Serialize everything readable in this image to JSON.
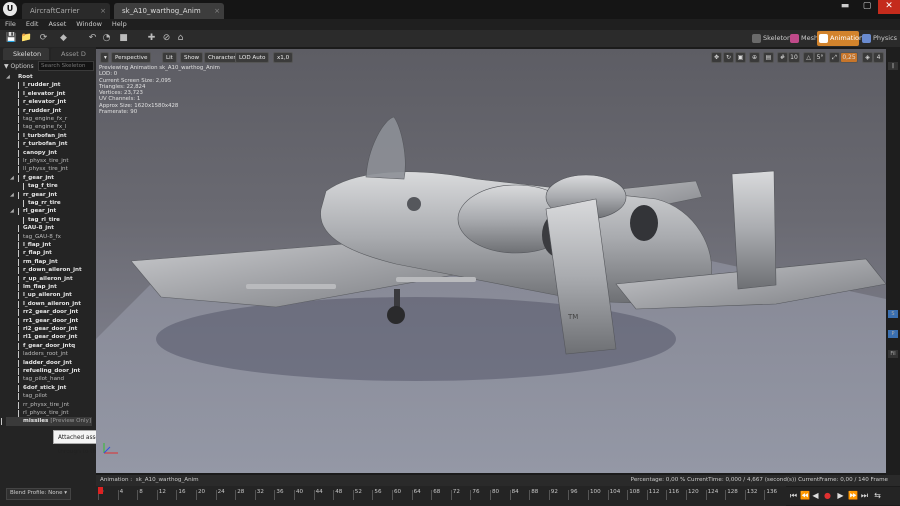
{
  "title_bar": {
    "tabs": [
      {
        "label": "AircraftCarrier",
        "close": "×"
      },
      {
        "label": "sk_A10_warthog_Anim",
        "close": "×"
      }
    ],
    "logo_letter": "U",
    "window_controls": [
      "▬",
      "▢",
      "✕"
    ]
  },
  "menu": [
    "File",
    "Edit",
    "Asset",
    "Window",
    "Help"
  ],
  "modes": [
    {
      "label": "Skeleton",
      "color": "#6a6a6a"
    },
    {
      "label": "Mesh",
      "color": "#c04a8a"
    },
    {
      "label": "Animation",
      "color": "#ffffff"
    },
    {
      "label": "Physics",
      "color": "#6a8bd0"
    }
  ],
  "left_panel": {
    "tabs": [
      "Skeleton",
      "Asset D"
    ],
    "options_label": "Options",
    "search_placeholder": "Search Skeleton",
    "tree": [
      {
        "label": "Root",
        "bold": true,
        "indent": 0
      },
      {
        "label": "l_rudder_jnt",
        "bold": true,
        "indent": 1
      },
      {
        "label": "l_elevator_jnt",
        "bold": true,
        "indent": 1
      },
      {
        "label": "r_elevator_jnt",
        "bold": true,
        "indent": 1
      },
      {
        "label": "r_rudder_jnt",
        "bold": true,
        "indent": 1
      },
      {
        "label": "tag_engine_fx_r",
        "bold": false,
        "indent": 1
      },
      {
        "label": "tag_engine_fx_l",
        "bold": false,
        "indent": 1
      },
      {
        "label": "l_turbofan_jnt",
        "bold": true,
        "indent": 1
      },
      {
        "label": "r_turbofan_jnt",
        "bold": true,
        "indent": 1
      },
      {
        "label": "canopy_jnt",
        "bold": true,
        "indent": 1
      },
      {
        "label": "lr_physx_tire_jnt",
        "bold": false,
        "indent": 1
      },
      {
        "label": "ll_physx_tire_jnt",
        "bold": false,
        "indent": 1
      },
      {
        "label": "f_gear_jnt",
        "bold": true,
        "indent": 1,
        "expand": true
      },
      {
        "label": "tag_f_tire",
        "bold": true,
        "indent": 2
      },
      {
        "label": "rr_gear_jnt",
        "bold": true,
        "indent": 1,
        "expand": true
      },
      {
        "label": "tag_rr_tire",
        "bold": true,
        "indent": 2
      },
      {
        "label": "rl_gear_jnt",
        "bold": true,
        "indent": 1,
        "expand": true
      },
      {
        "label": "tag_rl_tire",
        "bold": true,
        "indent": 2
      },
      {
        "label": "GAU-8_jnt",
        "bold": true,
        "indent": 1
      },
      {
        "label": "tag_GAU-8_fx",
        "bold": false,
        "indent": 1
      },
      {
        "label": "l_flap_jnt",
        "bold": true,
        "indent": 1
      },
      {
        "label": "r_flap_jnt",
        "bold": true,
        "indent": 1
      },
      {
        "label": "rm_flap_jnt",
        "bold": true,
        "indent": 1
      },
      {
        "label": "r_down_aileron_jnt",
        "bold": true,
        "indent": 1
      },
      {
        "label": "r_up_aileron_jnt",
        "bold": true,
        "indent": 1
      },
      {
        "label": "lm_flap_jnt",
        "bold": true,
        "indent": 1
      },
      {
        "label": "l_up_aileron_jnt",
        "bold": true,
        "indent": 1
      },
      {
        "label": "l_down_aileron_jnt",
        "bold": true,
        "indent": 1
      },
      {
        "label": "rr2_gear_door_jnt",
        "bold": true,
        "indent": 1
      },
      {
        "label": "rr1_gear_door_jnt",
        "bold": true,
        "indent": 1
      },
      {
        "label": "rl2_gear_door_jnt",
        "bold": true,
        "indent": 1
      },
      {
        "label": "rl1_gear_door_jnt",
        "bold": true,
        "indent": 1
      },
      {
        "label": "f_gear_door_jntq",
        "bold": true,
        "indent": 1
      },
      {
        "label": "ladders_root_jnt",
        "bold": false,
        "indent": 1
      },
      {
        "label": "ladder_door_jnt",
        "bold": true,
        "indent": 1
      },
      {
        "label": "refueling_door_jnt",
        "bold": true,
        "indent": 1
      },
      {
        "label": "tag_pilot_hand",
        "bold": false,
        "indent": 1
      },
      {
        "label": "6dof_stick_jnt",
        "bold": true,
        "indent": 1
      },
      {
        "label": "tag_pilot",
        "bold": false,
        "indent": 1
      },
      {
        "label": "rr_physx_tire_jnt",
        "bold": false,
        "indent": 1
      },
      {
        "label": "rl_physx_tire_jnt",
        "bold": false,
        "indent": 1
      },
      {
        "label": "missiles",
        "suffix": "[Preview Only]",
        "bold": true,
        "indent": 1
      }
    ],
    "tooltip": "Attached assets in Persona are preview only and do not carry through to the game.",
    "blend_profile": "Blend Profile: None"
  },
  "viewport": {
    "buttons": [
      "Perspective",
      "Lit",
      "Show",
      "Character",
      "LOD Auto",
      "x1,0"
    ],
    "right_controls": [
      "10",
      "5°",
      "0,25",
      "4"
    ],
    "stats": [
      "Previewing Animation sk_A10_warthog_Anim",
      "LOD: 0",
      "Current Screen Size: 2,095",
      "Triangles: 22,824",
      "Vertices: 23,723",
      "UV Channels: 1",
      "Approx Size: 1620x1580x428",
      "Framerate: 90"
    ],
    "fuselage_marking": "TM"
  },
  "bottom": {
    "animation_label": "Animation :",
    "animation_name": "sk_A10_warthog_Anim",
    "status": "Percentage:  0,00 %  CurrentTime:  0,000 / 4,667 (second(s))  CurrentFrame:  0,00 / 140 Frame",
    "ticks": [
      "0",
      "4",
      "8",
      "12",
      "16",
      "20",
      "24",
      "28",
      "32",
      "36",
      "40",
      "44",
      "48",
      "52",
      "56",
      "60",
      "64",
      "68",
      "72",
      "76",
      "80",
      "84",
      "88",
      "92",
      "96",
      "100",
      "104",
      "108",
      "112",
      "116",
      "120",
      "124",
      "128",
      "132",
      "136"
    ]
  },
  "transport": [
    "⏮",
    "⏪",
    "◀",
    "●",
    "▶",
    "⏩",
    "⏭",
    "⇆"
  ],
  "right_strip": [
    "S",
    "P",
    "Fil"
  ]
}
